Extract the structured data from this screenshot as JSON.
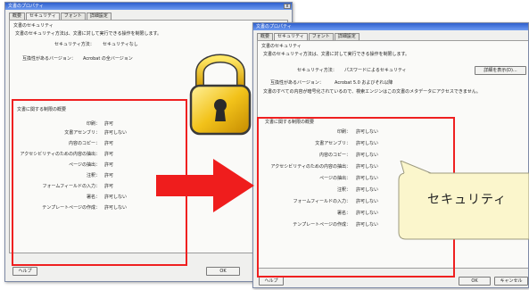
{
  "left_dialog": {
    "title": "文書のプロパティ",
    "close": "x",
    "tabs": [
      "概要",
      "セキュリティ",
      "フォント",
      "詳細設定"
    ],
    "section_title": "文書のセキュリティ",
    "desc": "文書のセキュリティ方法は、文書に対して実行できる操作を制限します。",
    "method_label": "セキュリティ方法：",
    "method_value": "セキュリティなし",
    "compat_label": "互換性があるバージョン：",
    "compat_value": "Acrobat の全バージョン",
    "restrict_title": "文書に関する制限の概要",
    "rows": [
      {
        "k": "印刷：",
        "v": "許可"
      },
      {
        "k": "文書アセンブリ：",
        "v": "許可しない"
      },
      {
        "k": "内容のコピー：",
        "v": "許可"
      },
      {
        "k": "アクセシビリティのための内容の抽出：",
        "v": "許可"
      },
      {
        "k": "ページの抽出：",
        "v": "許可"
      },
      {
        "k": "注釈：",
        "v": "許可"
      },
      {
        "k": "フォームフィールドの入力：",
        "v": "許可"
      },
      {
        "k": "署名：",
        "v": "許可しない"
      },
      {
        "k": "テンプレートページの作成：",
        "v": "許可しない"
      }
    ],
    "help": "ヘルプ",
    "ok": "OK"
  },
  "right_dialog": {
    "title": "文書のプロパティ",
    "tabs": [
      "概要",
      "セキュリティ",
      "フォント",
      "詳細設定"
    ],
    "section_title": "文書のセキュリティ",
    "desc": "文書のセキュリティ方法は、文書に対して実行できる操作を制限します。",
    "method_label": "セキュリティ方法：",
    "method_value": "パスワードによるセキュリティ",
    "details_button": "詳細を表示(D)...",
    "compat_label": "互換性があるバージョン：",
    "compat_value": "Acrobat 5.0 およびそれ以降",
    "notice": "文書のすべての内容が暗号化されているので、検索エンジンはこの文書のメタデータにアクセスできません。",
    "restrict_title": "文書に関する制限の概要",
    "rows": [
      {
        "k": "印刷：",
        "v": "許可しない"
      },
      {
        "k": "文書アセンブリ：",
        "v": "許可しない"
      },
      {
        "k": "内容のコピー：",
        "v": "許可しない"
      },
      {
        "k": "アクセシビリティのための内容の抽出：",
        "v": "許可しない"
      },
      {
        "k": "ページの抽出：",
        "v": "許可しない"
      },
      {
        "k": "注釈：",
        "v": "許可しない"
      },
      {
        "k": "フォームフィールドの入力：",
        "v": "許可しない"
      },
      {
        "k": "署名：",
        "v": "許可しない"
      },
      {
        "k": "テンプレートページの作成：",
        "v": "許可しない"
      }
    ],
    "help": "ヘルプ",
    "ok": "OK",
    "cancel": "キャンセル"
  },
  "callout": {
    "text": "セキュリティ"
  },
  "colors": {
    "highlight": "#ef2020",
    "lock_gold": "#f2c21a",
    "bubble": "#fbf6cc"
  },
  "icons": {
    "lock": "padlock-icon",
    "arrow": "right-arrow-icon"
  }
}
